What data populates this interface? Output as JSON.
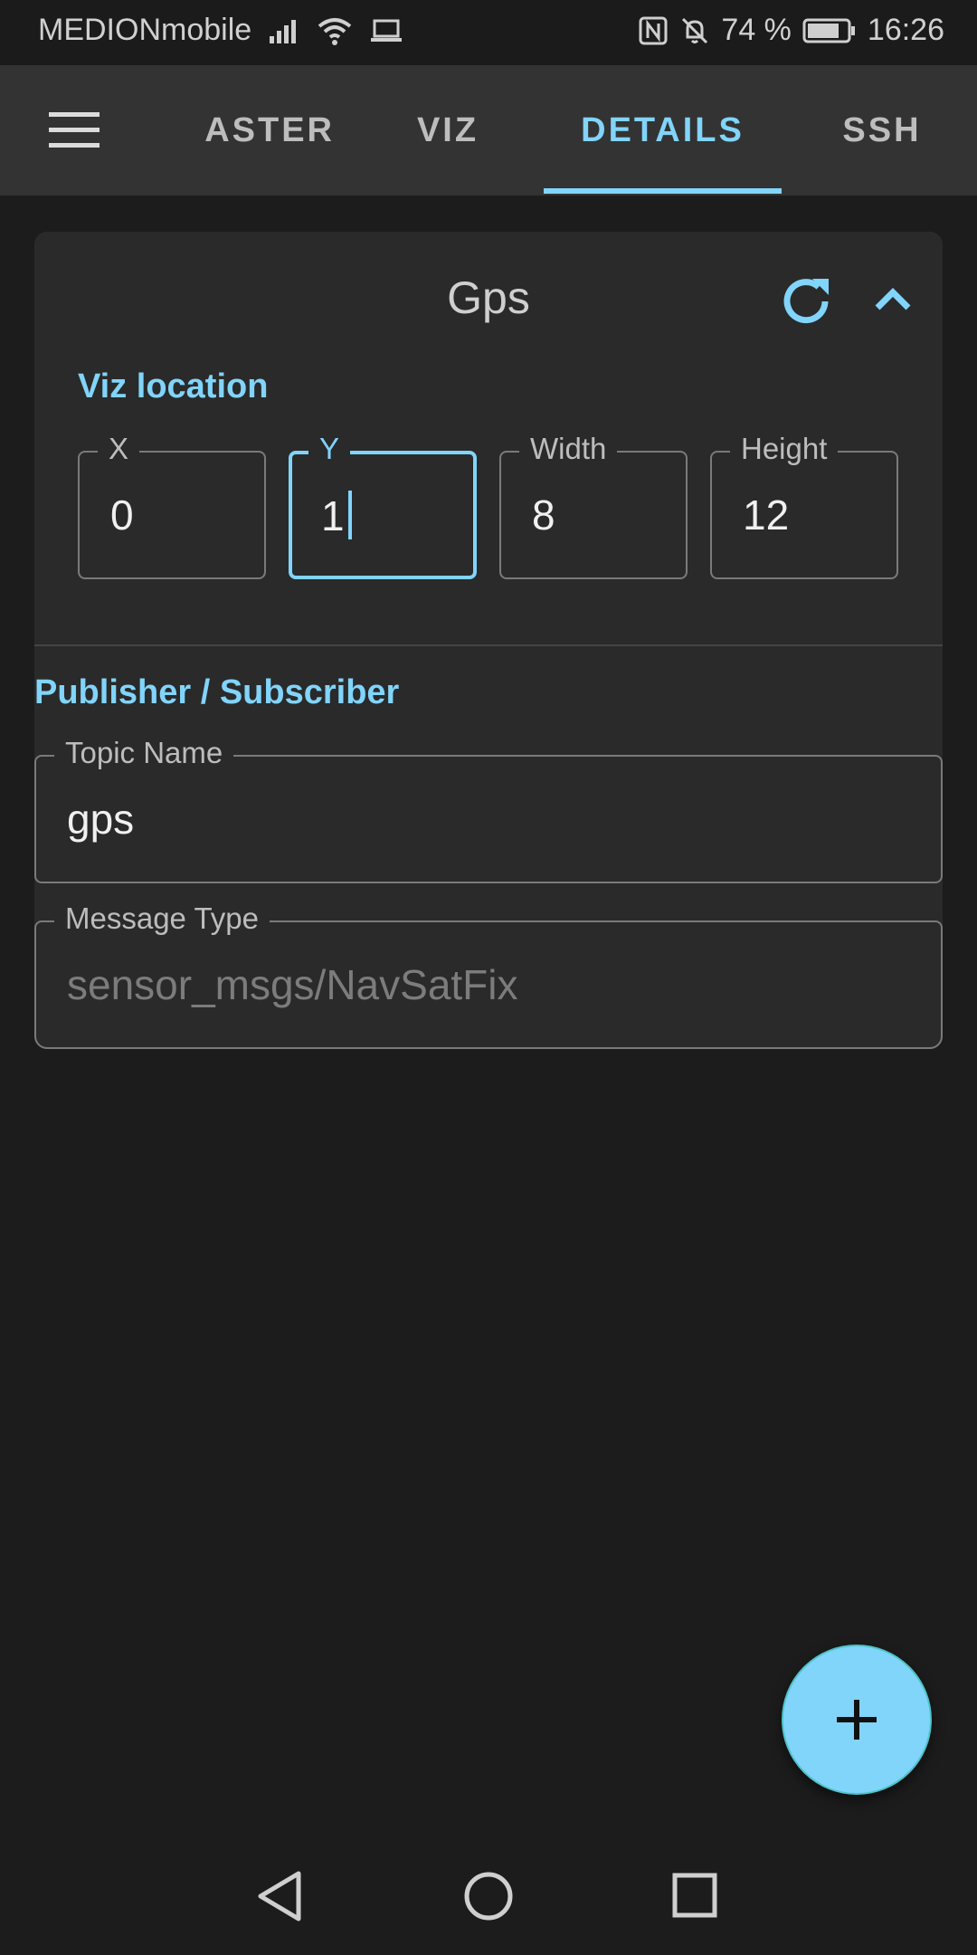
{
  "status_bar": {
    "carrier": "MEDIONmobile",
    "battery_percent": "74 %",
    "time": "16:26",
    "icons": [
      "signal-icon",
      "wifi-icon",
      "laptop-icon",
      "nfc-icon",
      "bell-off-icon",
      "battery-icon"
    ]
  },
  "tabs": [
    {
      "label": "ASTER"
    },
    {
      "label": "VIZ"
    },
    {
      "label": "DETAILS",
      "active": true
    },
    {
      "label": "SSH"
    }
  ],
  "card": {
    "title": "Gps",
    "viz_location": {
      "label": "Viz location",
      "x": {
        "label": "X",
        "value": "0"
      },
      "y": {
        "label": "Y",
        "value": "1"
      },
      "width": {
        "label": "Width",
        "value": "8"
      },
      "height": {
        "label": "Height",
        "value": "12"
      }
    },
    "pubsub": {
      "label": "Publisher / Subscriber",
      "topic": {
        "label": "Topic Name",
        "value": "gps"
      },
      "message_type": {
        "label": "Message Type",
        "value": "sensor_msgs/NavSatFix"
      }
    }
  },
  "fab": {
    "label": "+"
  },
  "colors": {
    "accent": "#81d4fa",
    "background": "#1c1c1c",
    "card": "#2a2a2a",
    "app_bar": "#333333"
  }
}
